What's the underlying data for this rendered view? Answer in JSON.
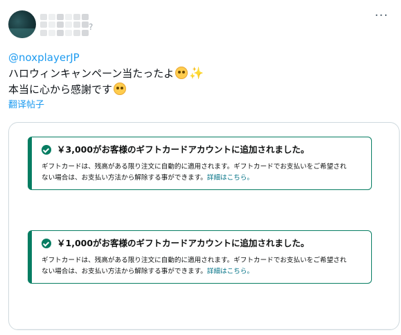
{
  "post": {
    "more_label": "···",
    "username_suffix": "?",
    "mention": "@noxplayerJP",
    "line1": "ハロウィンキャンペーン当たったよ",
    "line2": "本当に心から感謝です",
    "translate_label": "翻译帖子"
  },
  "cards": [
    {
      "title": "￥3,000がお客様のギフトカードアカウントに追加されました。",
      "body_line1": "ギフトカードは、残高がある限り注文に自動的に適用されます。ギフトカードでお支払いをご希望され",
      "body_line2": "ない場合は、お支払い方法から解除する事ができます。",
      "link": "詳細はこちら。"
    },
    {
      "title": "￥1,000がお客様のギフトカードアカウントに追加されました。",
      "body_line1": "ギフトカードは、残高がある限り注文に自動的に適用されます。ギフトカードでお支払いをご希望され",
      "body_line2": "ない場合は、お支払い方法から解除する事ができます。",
      "link": "詳細はこちら。"
    }
  ],
  "icons": {
    "face_emoji_1": "pleading-face-icon",
    "sparkle_emoji": "sparkles-icon",
    "face_emoji_2": "relieved-face-icon",
    "check": "check-circle-icon"
  },
  "colors": {
    "link": "#1d9bf0",
    "card_accent": "#067d62",
    "card_link": "#007185"
  }
}
